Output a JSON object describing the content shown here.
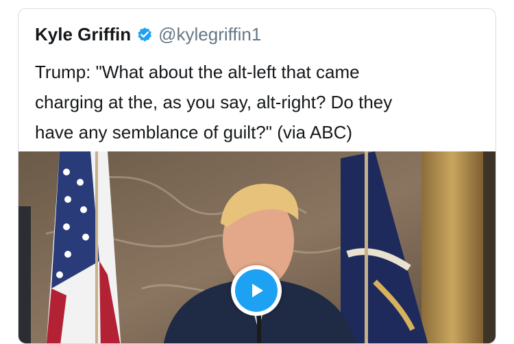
{
  "tweet": {
    "author_name": "Kyle Griffin",
    "handle": "@kylegriffin1",
    "verified": true,
    "text_lines": [
      "Trump: \"What about the alt-left that came",
      "charging at the, as you say, alt-right? Do they",
      "have any semblance of guilt?\" (via ABC)"
    ]
  },
  "media": {
    "type": "video",
    "play_icon": "play-icon"
  },
  "colors": {
    "accent": "#1da1f2",
    "text": "#14171a",
    "muted": "#657786"
  }
}
